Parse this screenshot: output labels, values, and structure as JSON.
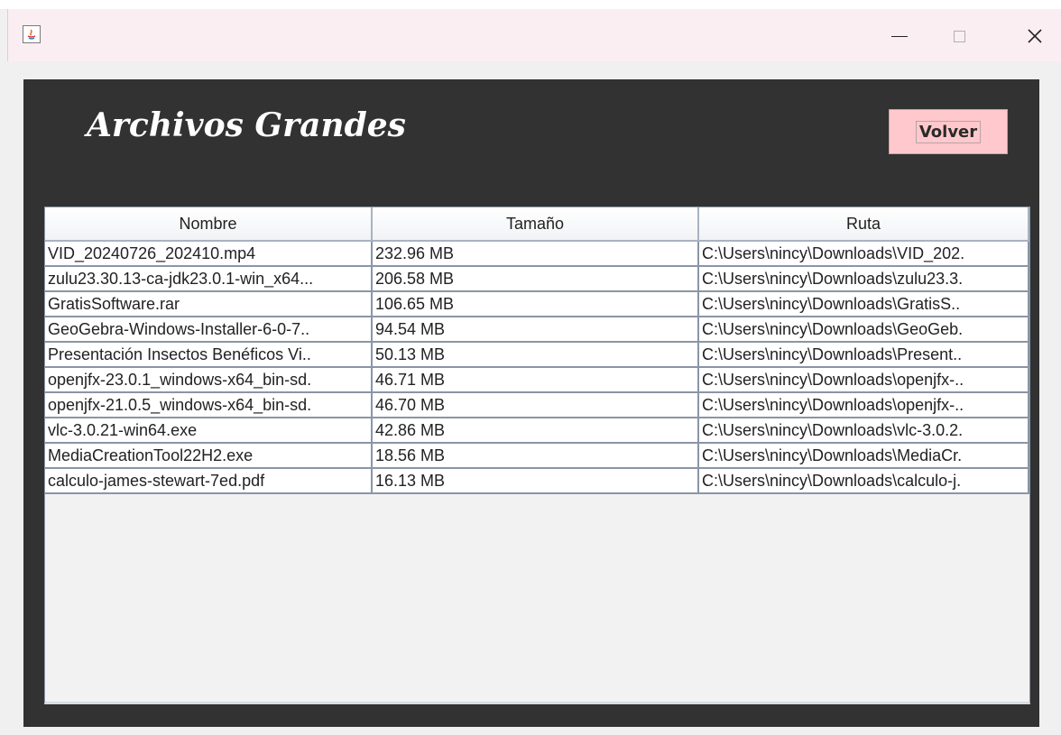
{
  "window": {
    "controls": {
      "minimize": "—",
      "maximize": "☐",
      "close": "✕"
    }
  },
  "header": {
    "title": "Archivos Grandes",
    "back_label": "Volver"
  },
  "table": {
    "columns": [
      "Nombre",
      "Tamaño",
      "Ruta"
    ],
    "rows": [
      {
        "name": "VID_20240726_202410.mp4",
        "size": "232.96 MB",
        "path": "C:\\Users\\nincy\\Downloads\\VID_202."
      },
      {
        "name": "zulu23.30.13-ca-jdk23.0.1-win_x64...",
        "size": "206.58 MB",
        "path": "C:\\Users\\nincy\\Downloads\\zulu23.3."
      },
      {
        "name": "GratisSoftware.rar",
        "size": "106.65 MB",
        "path": "C:\\Users\\nincy\\Downloads\\GratisS.."
      },
      {
        "name": "GeoGebra-Windows-Installer-6-0-7..",
        "size": "94.54 MB",
        "path": "C:\\Users\\nincy\\Downloads\\GeoGeb."
      },
      {
        "name": "Presentación Insectos Benéficos Vi..",
        "size": "50.13 MB",
        "path": "C:\\Users\\nincy\\Downloads\\Present.."
      },
      {
        "name": "openjfx-23.0.1_windows-x64_bin-sd.",
        "size": "46.71 MB",
        "path": "C:\\Users\\nincy\\Downloads\\openjfx-.."
      },
      {
        "name": "openjfx-21.0.5_windows-x64_bin-sd.",
        "size": "46.70 MB",
        "path": "C:\\Users\\nincy\\Downloads\\openjfx-.."
      },
      {
        "name": "vlc-3.0.21-win64.exe",
        "size": "42.86 MB",
        "path": "C:\\Users\\nincy\\Downloads\\vlc-3.0.2."
      },
      {
        "name": "MediaCreationTool22H2.exe",
        "size": "18.56 MB",
        "path": "C:\\Users\\nincy\\Downloads\\MediaCr."
      },
      {
        "name": "calculo-james-stewart-7ed.pdf",
        "size": "16.13 MB",
        "path": "C:\\Users\\nincy\\Downloads\\calculo-j."
      }
    ]
  },
  "colors": {
    "content_bg": "#323232",
    "button_bg": "#ffc8cc",
    "titlebar_bg": "#fbeef2"
  },
  "icons": {
    "app": "java-icon"
  }
}
